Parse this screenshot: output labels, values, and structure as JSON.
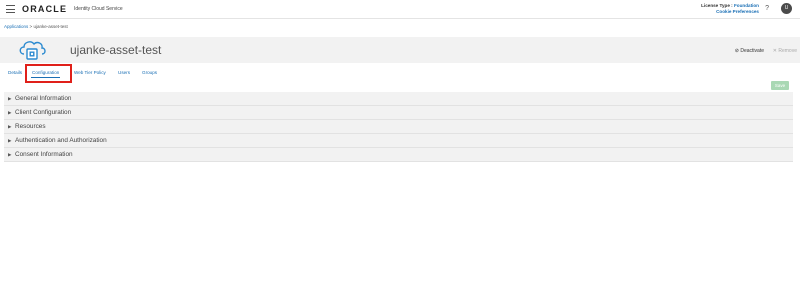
{
  "topbar": {
    "logo": "ORACLE",
    "app_name": "Identity Cloud Service",
    "license_label": "License Type :",
    "license_value": "Foundation",
    "cookie_link": "Cookie Preferences",
    "help": "?",
    "avatar_initials": "U"
  },
  "breadcrumb": {
    "parent": "Applications",
    "separator": ">",
    "current": "ujanke-asset-test"
  },
  "app": {
    "title": "ujanke-asset-test",
    "deactivate_label": "Deactivate",
    "deactivate_icon": "⊘",
    "remove_label": "Remove",
    "remove_icon": "✕"
  },
  "tabs": [
    {
      "label": "Details"
    },
    {
      "label": "Configuration"
    },
    {
      "label": "Web Tier Policy"
    },
    {
      "label": "Users"
    },
    {
      "label": "Groups"
    }
  ],
  "active_tab": "Configuration",
  "save_label": "Save",
  "sections": [
    {
      "label": "General Information"
    },
    {
      "label": "Client Configuration"
    },
    {
      "label": "Resources"
    },
    {
      "label": "Authentication and Authorization"
    },
    {
      "label": "Consent Information"
    }
  ],
  "colors": {
    "link": "#1a6fb5",
    "highlight": "#e0201a",
    "save_disabled": "#a9d8b4",
    "section_bg": "#f2f2f2"
  }
}
